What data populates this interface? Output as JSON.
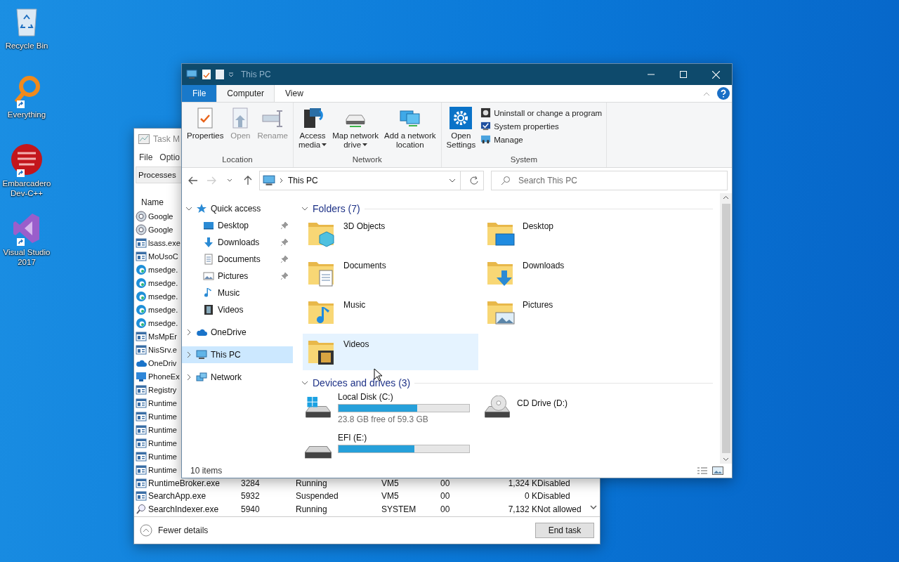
{
  "desktop_icons": [
    {
      "label": "Recycle Bin",
      "kind": "recycle-bin",
      "shortcut": false
    },
    {
      "label": "Everything",
      "kind": "magnifier",
      "shortcut": true
    },
    {
      "label": "Embarcadero Dev-C++",
      "kind": "dev-cpp",
      "shortcut": true
    },
    {
      "label": "Visual Studio 2017",
      "kind": "visual-studio",
      "shortcut": true
    }
  ],
  "task_manager": {
    "title": "Task M",
    "menu": [
      "File",
      "Optio"
    ],
    "tab": "Processes",
    "column_header": "Name",
    "rows": [
      {
        "kind": "gear-app",
        "name": "Google"
      },
      {
        "kind": "gear-app",
        "name": "Google"
      },
      {
        "kind": "app",
        "name": "lsass.exe"
      },
      {
        "kind": "app",
        "name": "MoUsoC"
      },
      {
        "kind": "edge",
        "name": "msedge."
      },
      {
        "kind": "edge",
        "name": "msedge."
      },
      {
        "kind": "edge",
        "name": "msedge."
      },
      {
        "kind": "edge",
        "name": "msedge."
      },
      {
        "kind": "edge",
        "name": "msedge."
      },
      {
        "kind": "app",
        "name": "MsMpEr"
      },
      {
        "kind": "app",
        "name": "NisSrv.e"
      },
      {
        "kind": "cloud",
        "name": "OneDriv"
      },
      {
        "kind": "phone",
        "name": "PhoneEx"
      },
      {
        "kind": "app",
        "name": "Registry"
      },
      {
        "kind": "app",
        "name": "Runtime"
      },
      {
        "kind": "app",
        "name": "Runtime"
      },
      {
        "kind": "app",
        "name": "Runtime"
      },
      {
        "kind": "app",
        "name": "Runtime"
      },
      {
        "kind": "app",
        "name": "Runtime"
      },
      {
        "kind": "app",
        "name": "Runtime"
      }
    ],
    "full_rows": [
      {
        "kind": "app",
        "cells": [
          "RuntimeBroker.exe",
          "3284",
          "Running",
          "VM5",
          "00",
          "1,324 K",
          "Disabled"
        ]
      },
      {
        "kind": "app",
        "cells": [
          "SearchApp.exe",
          "5932",
          "Suspended",
          "VM5",
          "00",
          "0 K",
          "Disabled"
        ]
      },
      {
        "kind": "search",
        "cells": [
          "SearchIndexer.exe",
          "5940",
          "Running",
          "SYSTEM",
          "00",
          "7,132 K",
          "Not allowed"
        ]
      }
    ],
    "fewer_details": "Fewer details",
    "end_task": "End task"
  },
  "explorer": {
    "title": "This PC",
    "ribbon_tabs": [
      {
        "label": "File",
        "kind": "file",
        "selected": false
      },
      {
        "label": "Computer",
        "kind": "tab",
        "selected": true
      },
      {
        "label": "View",
        "kind": "tab",
        "selected": false
      }
    ],
    "groups": [
      {
        "label": "Location",
        "buttons": [
          {
            "lines": [
              "Properties"
            ],
            "disabled": false,
            "dropdown": false
          },
          {
            "lines": [
              "Open"
            ],
            "disabled": true,
            "dropdown": false
          },
          {
            "lines": [
              "Rename"
            ],
            "disabled": true,
            "dropdown": false
          }
        ]
      },
      {
        "label": "Network",
        "buttons": [
          {
            "lines": [
              "Access",
              "media"
            ],
            "disabled": false,
            "dropdown": true
          },
          {
            "lines": [
              "Map network",
              "drive"
            ],
            "disabled": false,
            "dropdown": true
          },
          {
            "lines": [
              "Add a network",
              "location"
            ],
            "disabled": false,
            "dropdown": false
          }
        ]
      },
      {
        "label": "System",
        "buttons": [
          {
            "lines": [
              "Open",
              "Settings"
            ],
            "disabled": false,
            "dropdown": false
          }
        ],
        "list": [
          {
            "label": "Uninstall or change a program"
          },
          {
            "label": "System properties"
          },
          {
            "label": "Manage"
          }
        ]
      }
    ],
    "address": {
      "location": "This PC",
      "search_placeholder": "Search This PC"
    },
    "nav": [
      {
        "label": "Quick access",
        "kind": "star",
        "expanded": true,
        "children": [
          {
            "label": "Desktop",
            "kind": "desktop",
            "pinned": true
          },
          {
            "label": "Downloads",
            "kind": "downloads",
            "pinned": true
          },
          {
            "label": "Documents",
            "kind": "documents",
            "pinned": true
          },
          {
            "label": "Pictures",
            "kind": "pictures",
            "pinned": true
          },
          {
            "label": "Music",
            "kind": "music",
            "pinned": false
          },
          {
            "label": "Videos",
            "kind": "videos",
            "pinned": false
          }
        ]
      },
      {
        "label": "OneDrive",
        "kind": "cloud",
        "expanded": false,
        "selected": false
      },
      {
        "label": "This PC",
        "kind": "pc",
        "expanded": false,
        "selected": true
      },
      {
        "label": "Network",
        "kind": "network",
        "expanded": false,
        "selected": false
      }
    ],
    "folders": {
      "title": "Folders (7)",
      "expanded": true,
      "items": [
        {
          "label": "3D Objects",
          "kind": "cube",
          "hovered": false
        },
        {
          "label": "Desktop",
          "kind": "desktop",
          "hovered": false
        },
        {
          "label": "Documents",
          "kind": "documents",
          "hovered": false
        },
        {
          "label": "Downloads",
          "kind": "downloads",
          "hovered": false
        },
        {
          "label": "Music",
          "kind": "music",
          "hovered": false
        },
        {
          "label": "Pictures",
          "kind": "pictures",
          "hovered": false
        },
        {
          "label": "Videos",
          "kind": "videos",
          "hovered": true
        }
      ]
    },
    "drives": {
      "title": "Devices and drives (3)",
      "expanded": true,
      "items": [
        {
          "label": "Local Disk (C:)",
          "kind": "windows-disk",
          "level": 0.6,
          "free": "23.8 GB free of 59.3 GB"
        },
        {
          "label": "CD Drive (D:)",
          "kind": "cd"
        },
        {
          "label": "EFI (E:)",
          "kind": "disk",
          "level": 0.58
        }
      ]
    },
    "status": "10 items"
  }
}
